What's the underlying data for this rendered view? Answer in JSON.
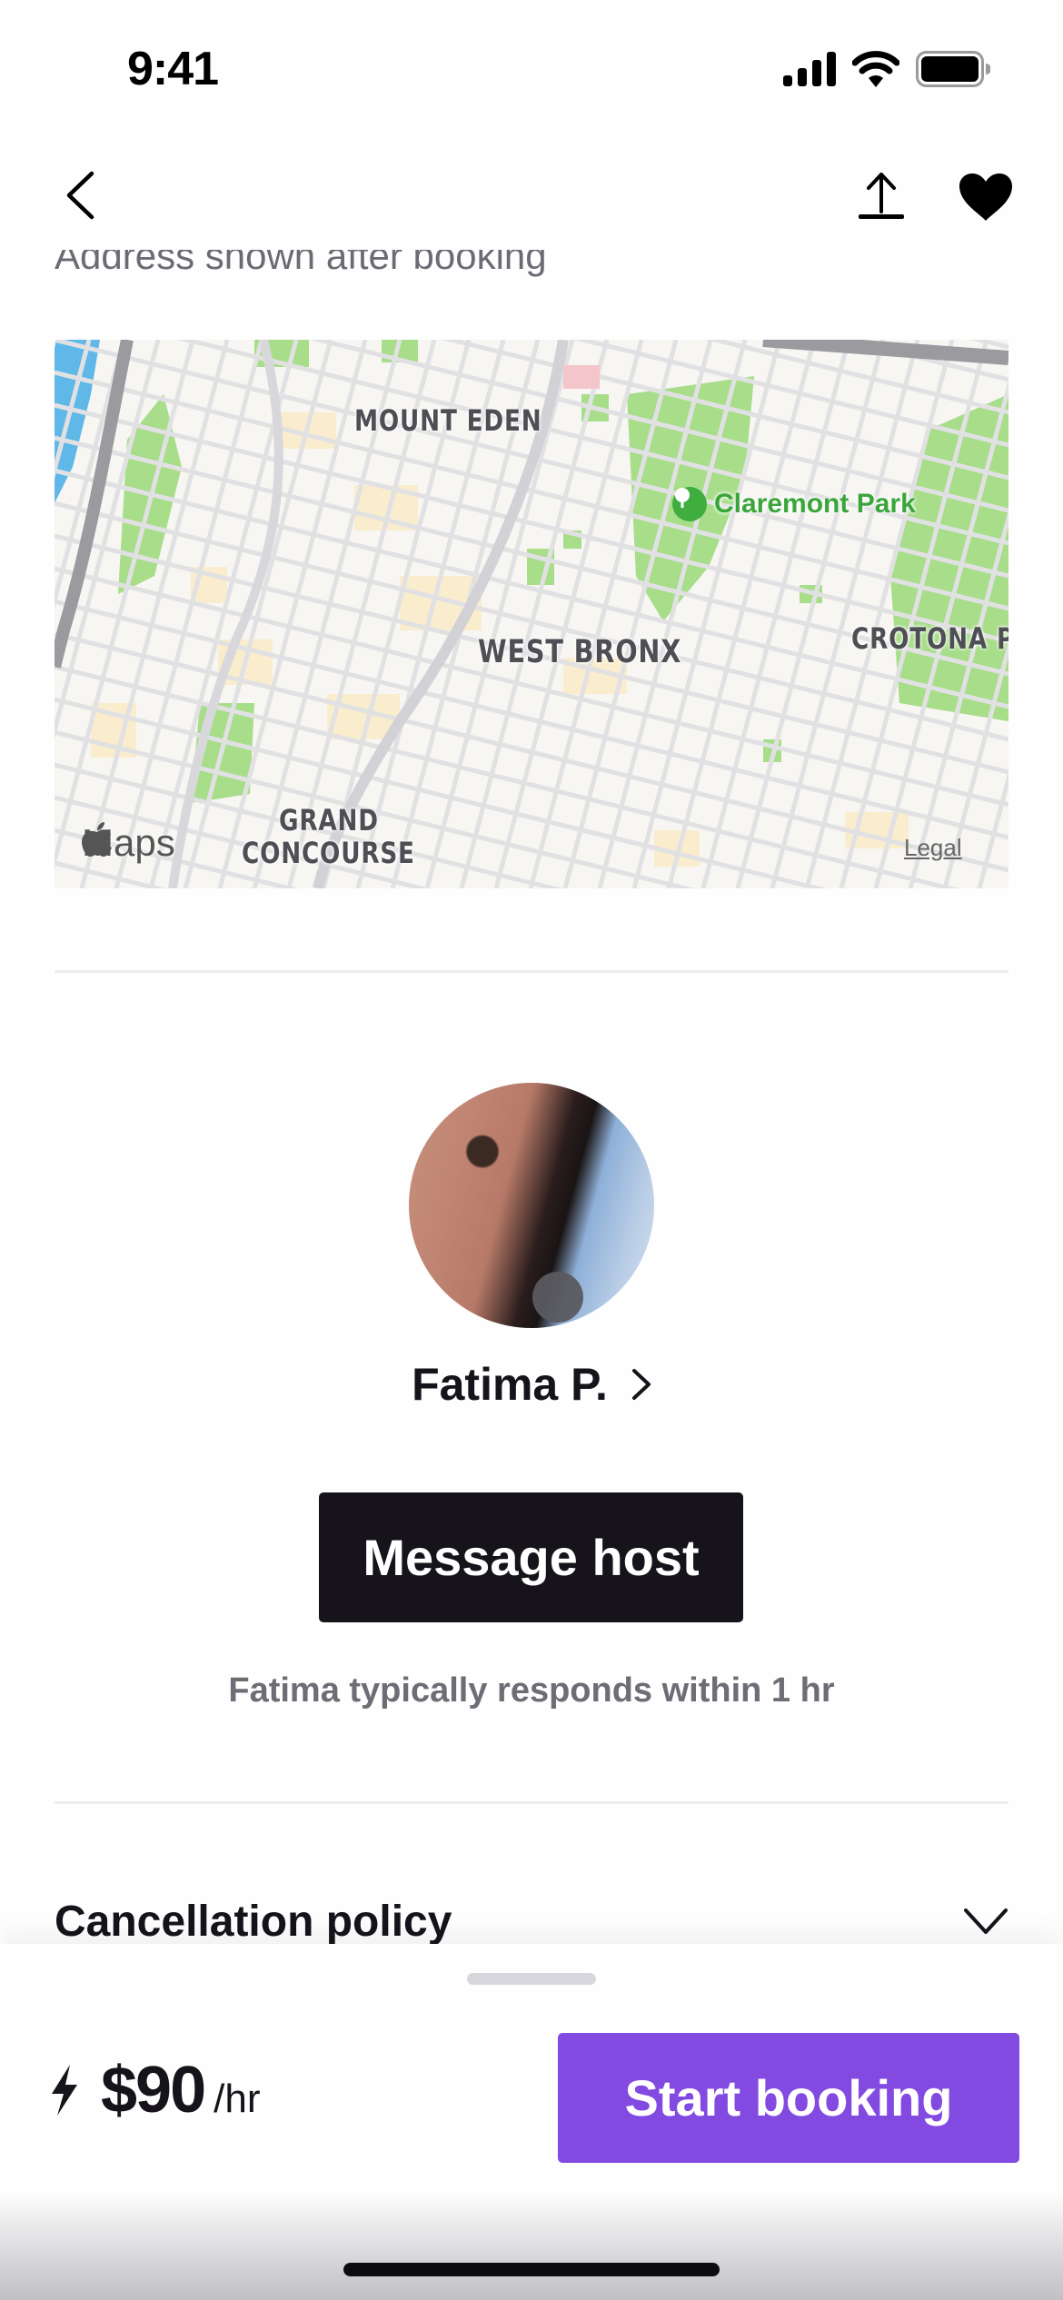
{
  "status_bar": {
    "time": "9:41"
  },
  "nav": {
    "back_icon": "chevron-left-icon",
    "share_icon": "share-upload-icon",
    "favorite_icon": "heart-filled-icon"
  },
  "location": {
    "address_note": "Address shown after booking",
    "map": {
      "neighborhoods": [
        "MOUNT EDEN",
        "WEST BRONX",
        "CROTONA PA",
        "GRAND",
        "CONCOURSE"
      ],
      "poi": "Claremont Park",
      "attribution": "Maps",
      "legal_link": "Legal",
      "colors": {
        "park": "#a8dd8a",
        "street": "#e1e1e3",
        "highway": "#9a9a9f",
        "water": "#5fb8e8",
        "commercial": "#faebc6",
        "land": "#f7f6f3"
      }
    }
  },
  "host": {
    "name": "Fatima P.",
    "message_button": "Message host",
    "response_note": "Fatima typically responds within 1 hr"
  },
  "policy": {
    "title": "Cancellation policy",
    "expand_icon": "chevron-down-icon"
  },
  "booking": {
    "instant_icon": "lightning-icon",
    "price": "$90",
    "unit": "/hr",
    "cta": "Start booking",
    "accent_color": "#834ae2"
  }
}
